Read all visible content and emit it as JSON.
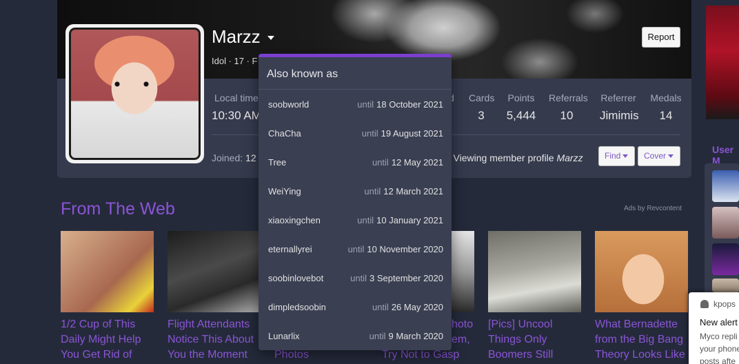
{
  "profile": {
    "username": "Marzz",
    "blurb": "Idol · 17 · F",
    "report_label": "Report",
    "stats": [
      {
        "label": "Local time",
        "value": "10:30 AM"
      },
      {
        "label": "Cards",
        "value": "3"
      },
      {
        "label": "Points",
        "value": "5,444"
      },
      {
        "label": "Referrals",
        "value": "10"
      },
      {
        "label": "Referrer",
        "value": "Jimimis"
      },
      {
        "label": "Medals",
        "value": "14"
      }
    ],
    "partial_label": "d",
    "joined_label": "Joined:",
    "joined_value": "12",
    "viewing_prefix": "· Viewing member profile",
    "viewing_name": "Marzz",
    "find_label": "Find",
    "cover_label": "Cover"
  },
  "aliases": {
    "title": "Also known as",
    "until_label": "until",
    "items": [
      {
        "name": "soobworld",
        "date": "18 October 2021"
      },
      {
        "name": "ChaCha",
        "date": "19 August 2021"
      },
      {
        "name": "Tree",
        "date": "12 May 2021"
      },
      {
        "name": "WeiYing",
        "date": "12 March 2021"
      },
      {
        "name": "xiaoxingchen",
        "date": "10 January 2021"
      },
      {
        "name": "eternallyrei",
        "date": "10 November 2020"
      },
      {
        "name": "soobinlovebot",
        "date": "3 September 2020"
      },
      {
        "name": "dimpledsoobin",
        "date": "26 May 2020"
      },
      {
        "name": "Lunarlix",
        "date": "9 March 2020"
      }
    ]
  },
  "web": {
    "title": "From The Web",
    "ads_label": "Ads by Revcontent",
    "ads": [
      {
        "title": "1/2 Cup of This Daily Might Help You Get Rid of",
        "color": "#c98b6a"
      },
      {
        "title": "Flight Attendants Notice This About You the Moment",
        "color": "#2b2b2b"
      },
      {
        "title": "Photos",
        "color": "#3a3f52"
      },
      {
        "title": "hoto\nem,\nTry Not to Gasp",
        "color": "#d8d8d8"
      },
      {
        "title": "[Pics] Uncool Things Only Boomers Still",
        "color": "#8f8f88"
      },
      {
        "title": "What Bernadette from the Big Bang Theory Looks Like",
        "color": "#d9935f"
      }
    ]
  },
  "sidebar": {
    "user_label": "User M"
  },
  "notification": {
    "brand": "kpops",
    "head": "New alert",
    "body_lines": [
      "Myco repli",
      "your phone",
      "posts afte"
    ]
  }
}
